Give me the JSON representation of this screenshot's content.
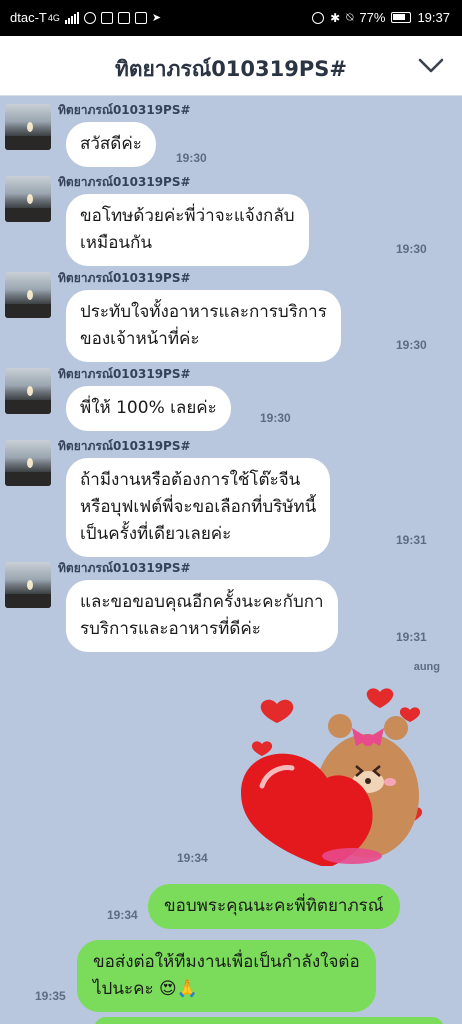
{
  "status_bar": {
    "carrier": "dtac-T",
    "network": "4G",
    "battery_pct": "77%",
    "clock": "19:37"
  },
  "header": {
    "title": "ทิตยาภรณ์010319PS#",
    "chevron_icon": "chevron-down-icon"
  },
  "messages": [
    {
      "sender": "ทิตยาภรณ์010319PS#",
      "text": "สวัสดีค่ะ",
      "time": "19:30"
    },
    {
      "sender": "ทิตยาภรณ์010319PS#",
      "text": "ขอโทษด้วยค่ะพี่ว่าจะแจ้งกลับ\nเหมือนกัน",
      "time": "19:30"
    },
    {
      "sender": "ทิตยาภรณ์010319PS#",
      "text": "ประทับใจทั้งอาหารและการบริการ\nของเจ้าหน้าที่ค่ะ",
      "time": "19:30"
    },
    {
      "sender": "ทิตยาภรณ์010319PS#",
      "text": "พี่ให้ 100% เลยค่ะ",
      "time": "19:30"
    },
    {
      "sender": "ทิตยาภรณ์010319PS#",
      "text": "ถ้ามีงานหรือต้องการใช้โต๊ะจีน\nหรือบุฟเฟต์พี่จะขอเลือกที่บริษัทนี้\nเป็นครั้งที่เดียวเลยค่ะ",
      "time": "19:31"
    },
    {
      "sender": "ทิตยาภรณ์010319PS#",
      "text": "และขอขอบคุณอีกครั้งนะคะกับกา\nรบริการและอาหารที่ดีค่ะ",
      "time": "19:31"
    }
  ],
  "me": {
    "name": "aung",
    "sticker_time": "19:34",
    "replies": [
      {
        "text": "ขอบพระคุณนะคะพี่ทิตยาภรณ์",
        "time": "19:34"
      },
      {
        "text": "ขอส่งต่อให้ทีมงานเพื่อเป็นกำลังใจต่อ\nไปนะคะ 😍🙏",
        "time": "19:35"
      }
    ]
  },
  "colors": {
    "chat_bg": "#b8c7de",
    "outgoing_bubble": "#7bdc5b",
    "incoming_bubble": "#ffffff"
  }
}
